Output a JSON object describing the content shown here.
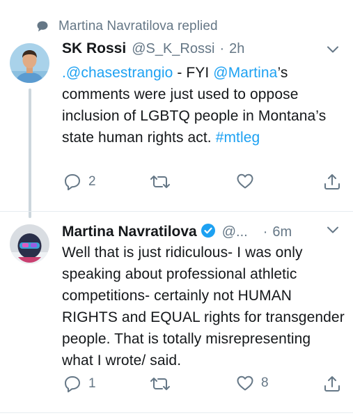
{
  "context": {
    "text": "Martina Navratilova replied",
    "icon": "speech-bubble-icon"
  },
  "tweets": [
    {
      "name": "SK Rossi",
      "handle": "@S_K_Rossi",
      "separator": "·",
      "time": "2h",
      "body": {
        "mention1": ".@chasestrangio",
        "text1": " - FYI ",
        "mention2": "@Martina",
        "text2": "’s comments were just used to oppose inclusion of LGBTQ people in Montana’s state human rights act. ",
        "hashtag": "#mtleg"
      },
      "actions": {
        "replies": "2",
        "retweets": "",
        "likes": ""
      }
    },
    {
      "name": "Martina Navratilova",
      "handle": "@...",
      "separator": "·",
      "time": "6m",
      "verified": true,
      "body": {
        "text": "Well that is just ridiculous- I was only speaking about professional athletic competitions- certainly not HUMAN RIGHTS and EQUAL rights for transgender people. That is totally misrepresenting what I wrote/ said."
      },
      "actions": {
        "replies": "1",
        "retweets": "",
        "likes": "8"
      }
    }
  ],
  "colors": {
    "link": "#1da1f2",
    "secondary": "#657786",
    "thread_line": "#ccd6dd"
  }
}
